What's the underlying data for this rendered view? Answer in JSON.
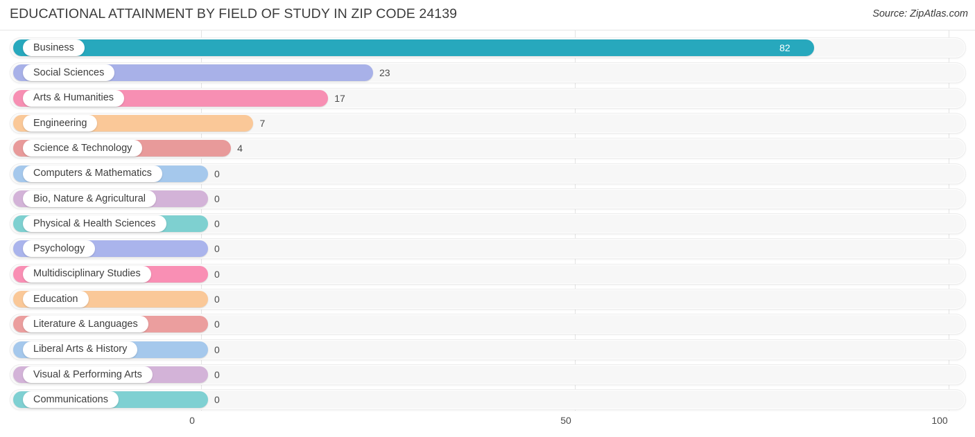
{
  "header": {
    "title": "EDUCATIONAL ATTAINMENT BY FIELD OF STUDY IN ZIP CODE 24139",
    "source": "Source: ZipAtlas.com"
  },
  "chart_data": {
    "type": "bar",
    "orientation": "horizontal",
    "title": "EDUCATIONAL ATTAINMENT BY FIELD OF STUDY IN ZIP CODE 24139",
    "xlabel": "",
    "ylabel": "",
    "xlim": [
      0,
      100
    ],
    "xticks": [
      0,
      50,
      100
    ],
    "xtick_labels": [
      "0",
      "50",
      "100"
    ],
    "grid": true,
    "legend": false,
    "categories": [
      "Business",
      "Social Sciences",
      "Arts & Humanities",
      "Engineering",
      "Science & Technology",
      "Computers & Mathematics",
      "Bio, Nature & Agricultural",
      "Physical & Health Sciences",
      "Psychology",
      "Multidisciplinary Studies",
      "Education",
      "Literature & Languages",
      "Liberal Arts & History",
      "Visual & Performing Arts",
      "Communications"
    ],
    "values": [
      82,
      23,
      17,
      7,
      4,
      0,
      0,
      0,
      0,
      0,
      0,
      0,
      0,
      0,
      0
    ],
    "value_labels": [
      "82",
      "23",
      "17",
      "7",
      "4",
      "0",
      "0",
      "0",
      "0",
      "0",
      "0",
      "0",
      "0",
      "0",
      "0"
    ],
    "colors": [
      "#27a8bd",
      "#a8b1e8",
      "#f78fb3",
      "#fac898",
      "#e89a9a",
      "#a5c8ec",
      "#d3b3d8",
      "#7ed0d0",
      "#aab4ec",
      "#f98fb4",
      "#fac898",
      "#eb9e9e",
      "#a5c8ec",
      "#d3b3d8",
      "#7fd0d2"
    ]
  }
}
